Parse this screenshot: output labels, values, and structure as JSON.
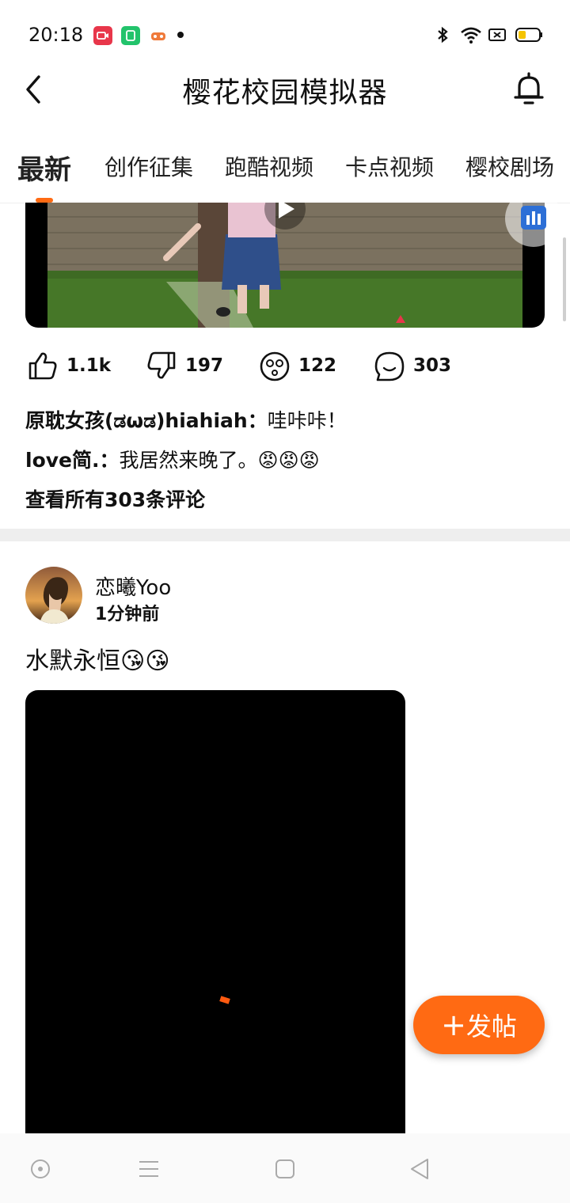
{
  "status_bar": {
    "time": "20:18"
  },
  "header": {
    "title": "樱花校园模拟器"
  },
  "tabs": [
    {
      "label": "最新"
    },
    {
      "label": "创作征集"
    },
    {
      "label": "跑酷视频"
    },
    {
      "label": "卡点视频"
    },
    {
      "label": "樱校剧场"
    }
  ],
  "post1": {
    "stats": {
      "likes": "1.1k",
      "dislikes": "197",
      "reactions": "122",
      "comments": "303"
    },
    "comments": [
      {
        "user": "原耽女孩(ಡωಡ)hiahiah：",
        "text": "哇咔咔！"
      },
      {
        "user": "love简.：",
        "text": "我居然来晚了。😡😡😡"
      }
    ],
    "view_all": "查看所有303条评论"
  },
  "post2": {
    "username": "恋曦Yoo",
    "time": "1分钟前",
    "text": "水默永恒😘😘"
  },
  "fab": {
    "label": "发帖"
  },
  "colors": {
    "accent": "#ff6a13"
  }
}
